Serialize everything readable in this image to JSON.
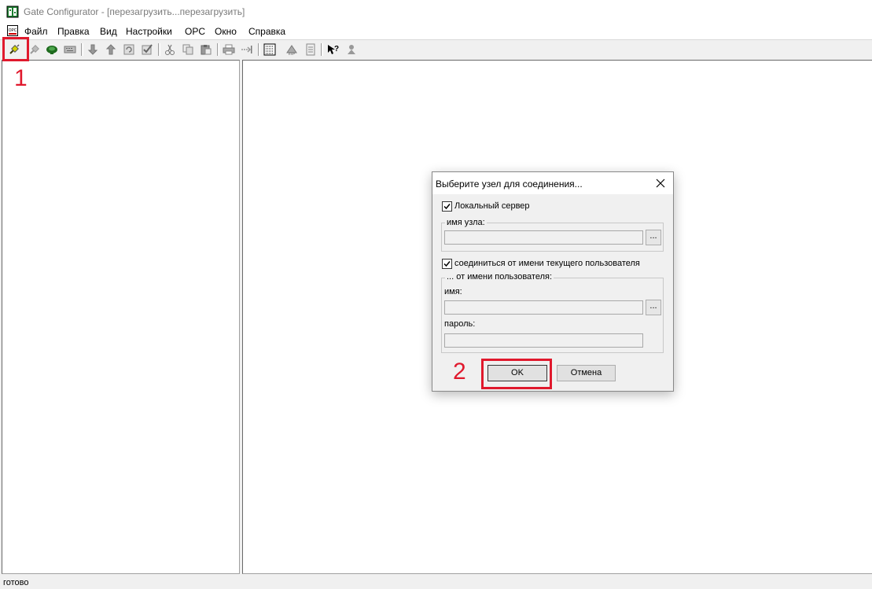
{
  "window": {
    "title": "Gate Configurator - [перезагрузить...перезагрузить]"
  },
  "menu": {
    "items": [
      "Файл",
      "Правка",
      "Вид",
      "Настройки",
      "OPC",
      "Окно",
      "Справка"
    ]
  },
  "toolbar": {
    "icons": [
      "connect-icon",
      "disconnect-icon",
      "network-icon",
      "keyboard-icon",
      "arrow-down-icon",
      "arrow-up-icon",
      "refresh-icon",
      "check-icon",
      "cut-icon",
      "copy-icon",
      "paste-icon",
      "print-icon",
      "forward-icon",
      "list-icon",
      "export-icon",
      "document-icon",
      "help-icon",
      "tools-icon"
    ]
  },
  "annotations": {
    "step1": "1",
    "step2": "2",
    "color": "#e0192d"
  },
  "dialog": {
    "title": "Выберите узел для соединения...",
    "local_server_label": "Локальный сервер",
    "local_server_checked": true,
    "node_group_label": "имя узла:",
    "node_value": "",
    "browse_label": "...",
    "current_user_label": "соединиться от имени текущего пользователя",
    "current_user_checked": true,
    "user_group_label": "... от имени пользователя:",
    "username_label": "имя:",
    "username_value": "",
    "password_label": "пароль:",
    "password_value": "",
    "ok_label": "OK",
    "cancel_label": "Отмена"
  },
  "status": {
    "text": "готово"
  }
}
